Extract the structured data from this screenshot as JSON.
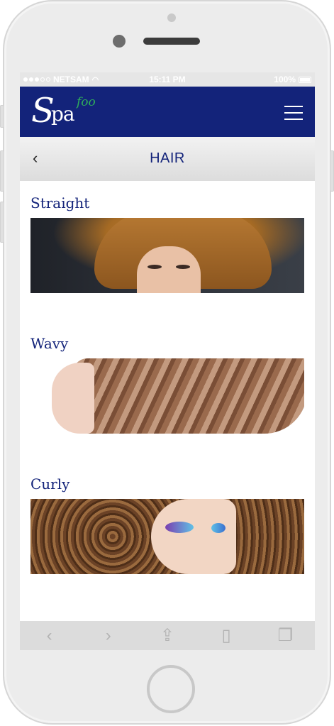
{
  "status_bar": {
    "carrier": "NETSAM",
    "time": "15:11 PM",
    "battery": "100%",
    "signal_dots_filled": 3,
    "signal_dots_total": 5
  },
  "header": {
    "logo_s": "S",
    "logo_pa": "pa",
    "logo_foo": "foo",
    "background_color": "#13237a",
    "logo_accent_color": "#2fae5b"
  },
  "sub_header": {
    "back_icon": "chevron-left-icon",
    "title": "HAIR"
  },
  "sections": [
    {
      "label": "Straight",
      "image": "straight-hair-photo"
    },
    {
      "label": "Wavy",
      "image": "wavy-hair-photo"
    },
    {
      "label": "Curly",
      "image": "curly-hair-photo"
    }
  ],
  "safari_toolbar": {
    "icons": [
      "back-arrow-icon",
      "forward-arrow-icon",
      "share-icon",
      "bookmarks-icon",
      "tabs-icon"
    ]
  }
}
